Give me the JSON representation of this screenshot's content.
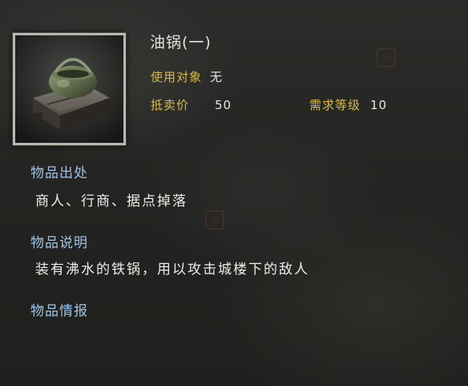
{
  "item": {
    "name": "油锅(一)",
    "icon": "iron-cauldron-icon",
    "use_target_label": "使用对象",
    "use_target_value": "无",
    "sell_price_label": "抵卖价",
    "sell_price_value": "50",
    "level_label": "需求等级",
    "level_value": "10"
  },
  "sections": {
    "source_title": "物品出处",
    "source_text": "商人、行商、据点掉落",
    "description_title": "物品说明",
    "description_text": "装有沸水的铁锅，用以攻击城楼下的敌人",
    "info_title": "物品情报"
  },
  "colors": {
    "label": "#d7bb45",
    "section_title": "#9fc3e6",
    "text": "#ecece8"
  }
}
